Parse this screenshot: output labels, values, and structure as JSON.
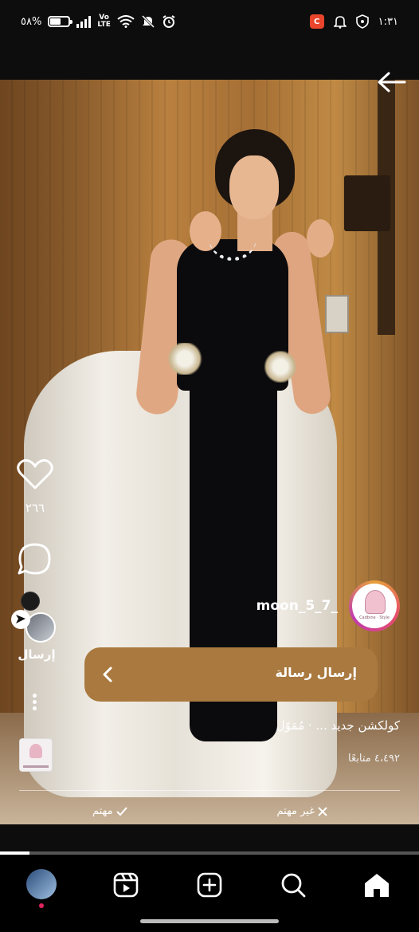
{
  "status_bar": {
    "battery_text": "٥٨%",
    "battery_level": 0.58,
    "volte_line1": "Vo",
    "volte_line2": "LTE",
    "time": "١:٣١"
  },
  "post": {
    "like_count": "٢٦٦",
    "share_label": "إرسال",
    "username": "moon_5_7_",
    "cta_label": "إرسال رسالة",
    "caption": "كولكشن جديد ... · مُمَوّل",
    "followers": "٤،٤٩٢ متابعًا",
    "feedback_interested": "مهتم",
    "feedback_not_interested": "غير مهتم",
    "profile_logo_text": "Cadbine · Style",
    "video_progress": 0.07
  },
  "icons": {
    "back": "arrow-right-icon",
    "like": "heart-icon",
    "comment": "comment-icon",
    "share": "send-icon",
    "more": "more-vertical-icon",
    "reels": "reels-icon",
    "create": "plus-square-icon",
    "search": "search-icon",
    "home": "home-icon"
  },
  "colors": {
    "cta_background": "#a9793f",
    "notification_dot": "#e0245e"
  }
}
